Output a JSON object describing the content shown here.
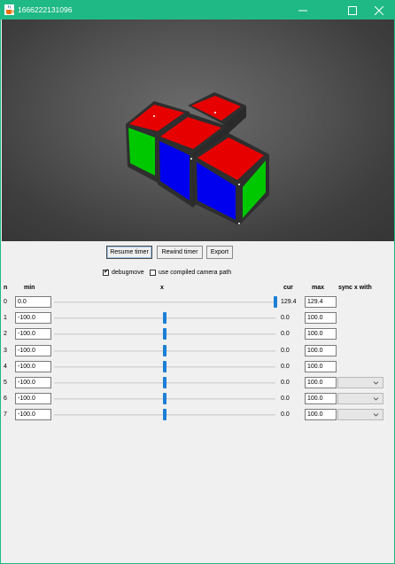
{
  "window": {
    "title": "1666222131096"
  },
  "toolbar": {
    "resume_label": "Resume timer",
    "rewind_label": "Rewind timer",
    "export_label": "Export"
  },
  "options": {
    "debugmove_label": "debugmove",
    "debugmove_checked": true,
    "compiled_path_label": "use compiled camera path",
    "compiled_path_checked": false
  },
  "table": {
    "headers": {
      "n": "n",
      "min": "min",
      "x": "x",
      "cur": "cur",
      "max": "max",
      "sync": "sync x with"
    },
    "rows": [
      {
        "n": "0",
        "min": "0.0",
        "cur": "129.4",
        "max": "129.4",
        "slider_fraction": 1.0,
        "has_sync": false
      },
      {
        "n": "1",
        "min": "-100.0",
        "cur": "0.0",
        "max": "100.0",
        "slider_fraction": 0.5,
        "has_sync": false
      },
      {
        "n": "2",
        "min": "-100.0",
        "cur": "0.0",
        "max": "100.0",
        "slider_fraction": 0.5,
        "has_sync": false
      },
      {
        "n": "3",
        "min": "-100.0",
        "cur": "0.0",
        "max": "100.0",
        "slider_fraction": 0.5,
        "has_sync": false
      },
      {
        "n": "4",
        "min": "-100.0",
        "cur": "0.0",
        "max": "100.0",
        "slider_fraction": 0.5,
        "has_sync": false
      },
      {
        "n": "5",
        "min": "-100.0",
        "cur": "0.0",
        "max": "100.0",
        "slider_fraction": 0.5,
        "has_sync": true
      },
      {
        "n": "6",
        "min": "-100.0",
        "cur": "0.0",
        "max": "100.0",
        "slider_fraction": 0.5,
        "has_sync": true
      },
      {
        "n": "7",
        "min": "-100.0",
        "cur": "0.0",
        "max": "100.0",
        "slider_fraction": 0.5,
        "has_sync": true
      }
    ]
  },
  "colors": {
    "titlebar": "#1fb985",
    "slider_thumb": "#1c7fd6",
    "cube_top": "#e60000",
    "cube_front": "#0000ee",
    "cube_side": "#00c800",
    "cube_frame": "#2e2e2e"
  },
  "icons": {
    "app": "java-cup-icon",
    "minimize": "minimize-icon",
    "maximize": "maximize-icon",
    "close": "close-icon",
    "dropdown": "chevron-down-icon"
  }
}
